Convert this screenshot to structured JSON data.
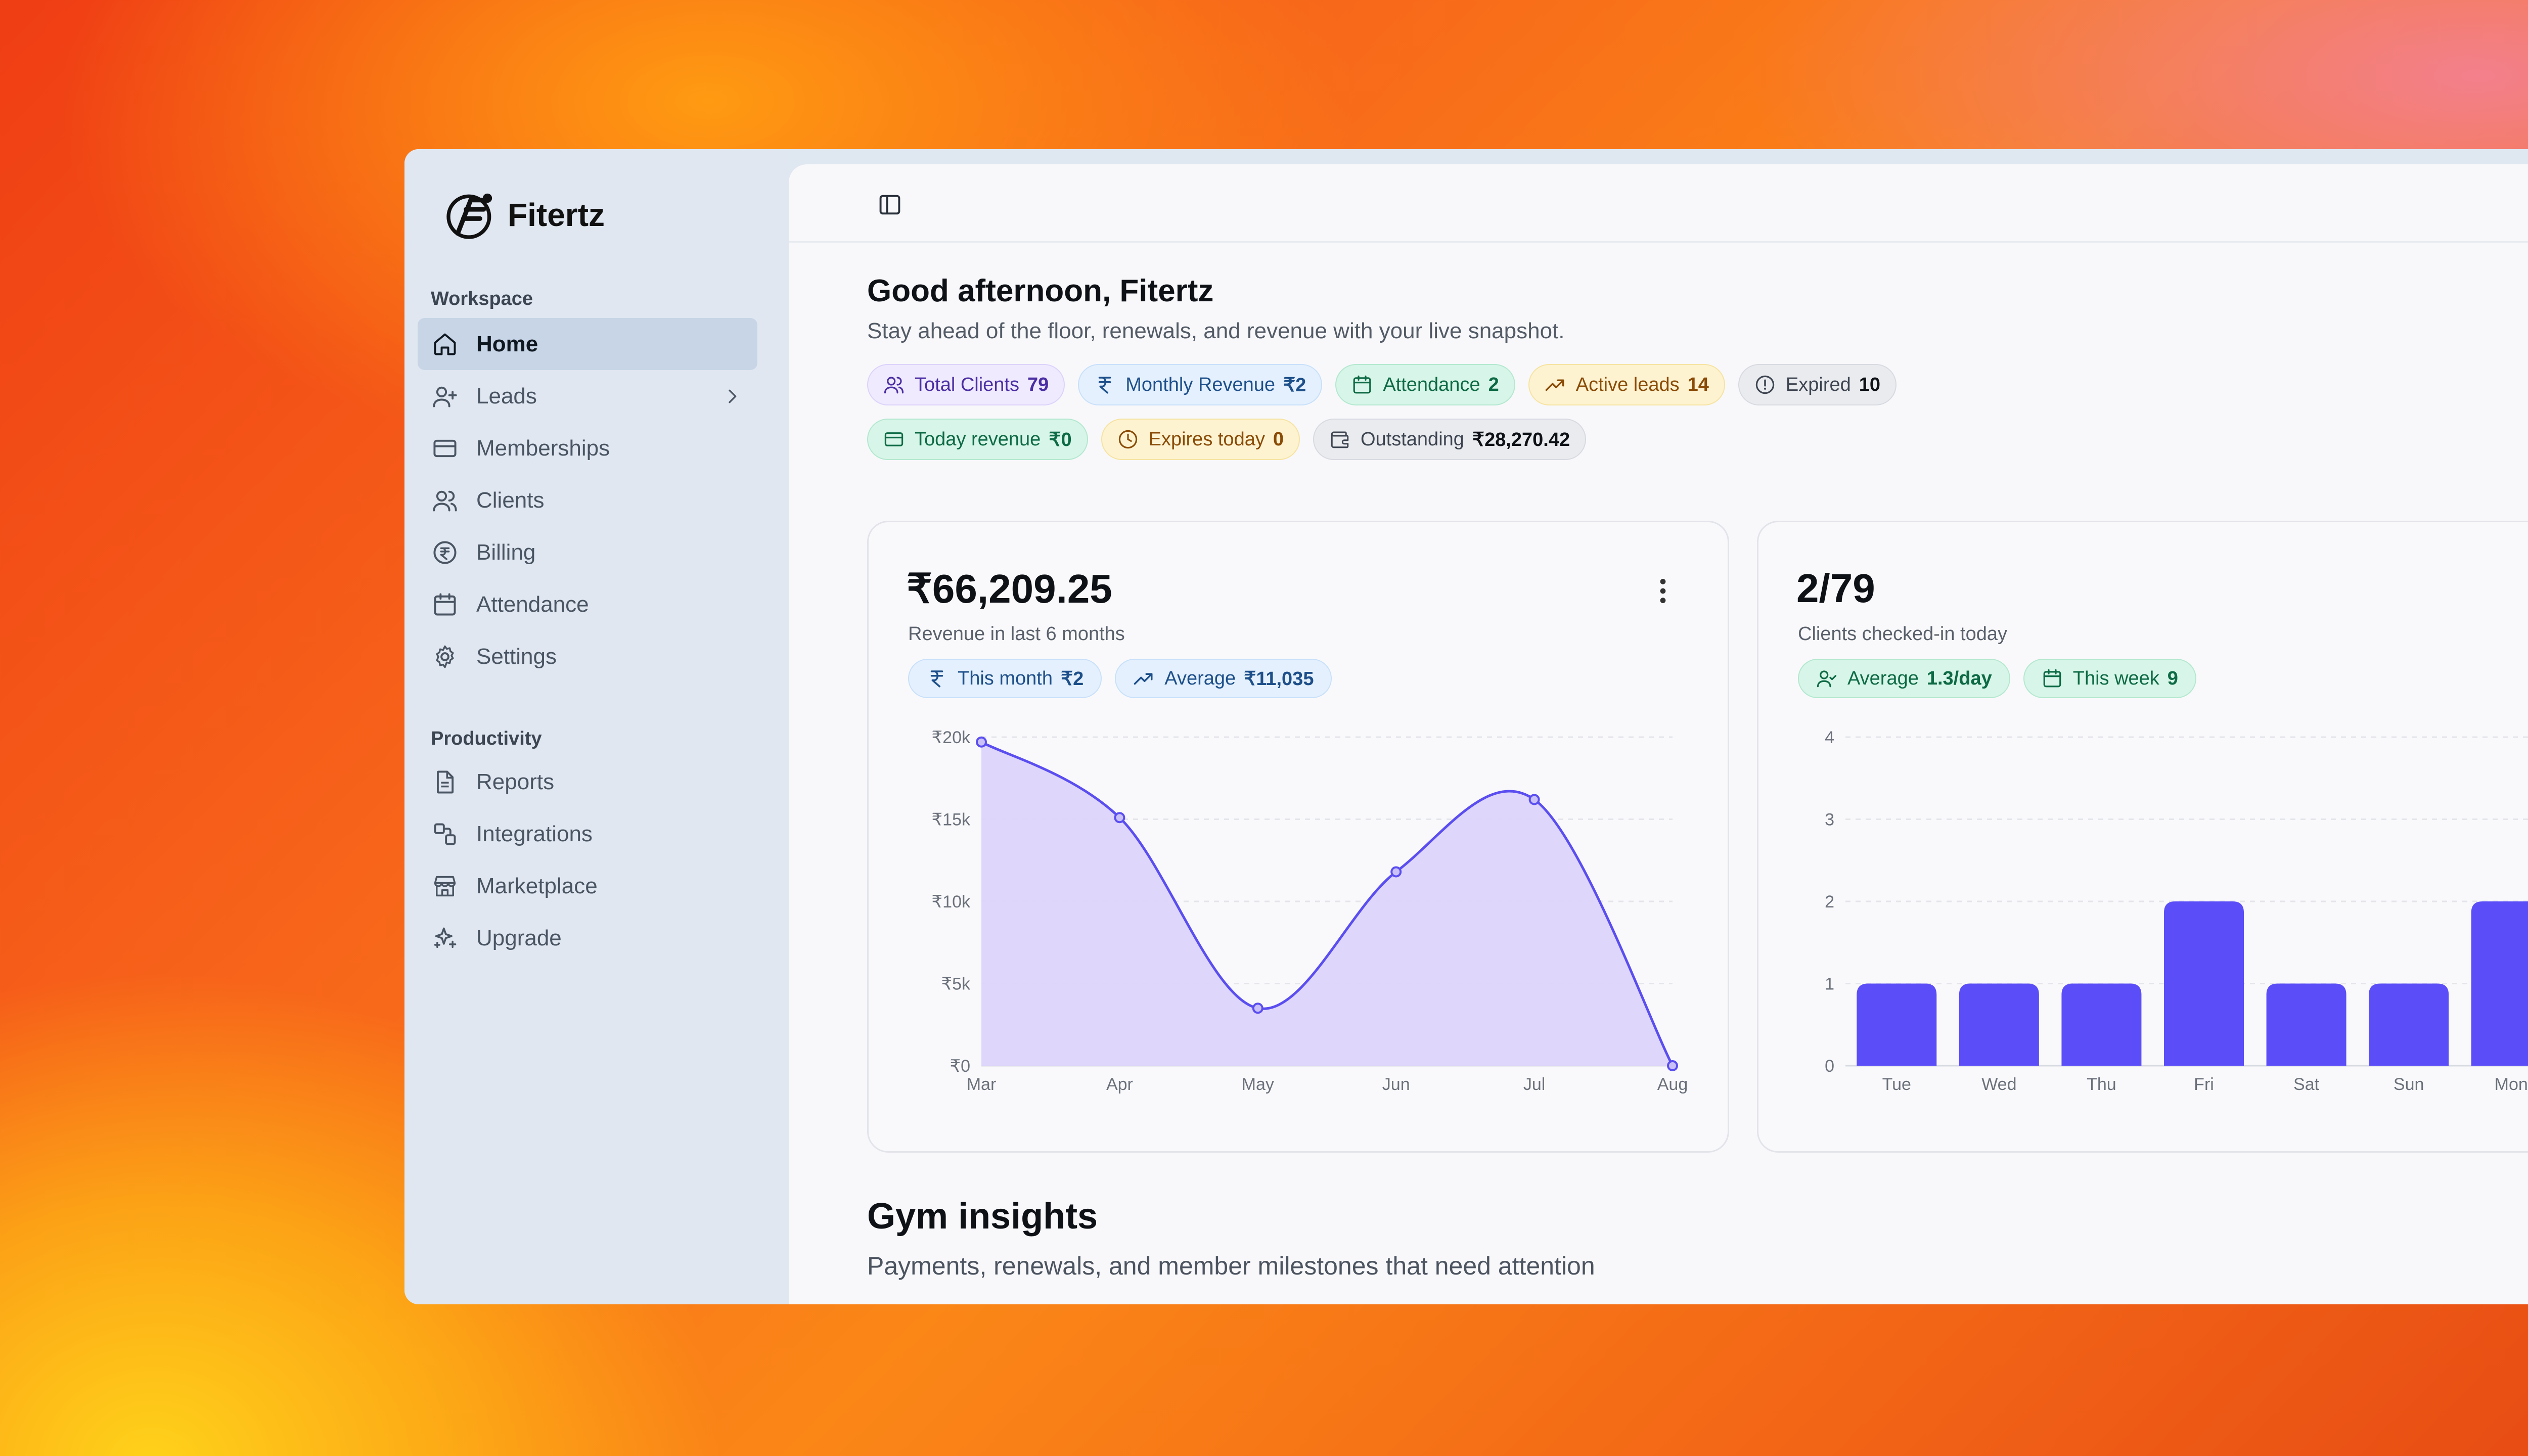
{
  "brand": {
    "name": "Fitertz"
  },
  "sidebar": {
    "workspace_label": "Workspace",
    "productivity_label": "Productivity",
    "workspace_items": [
      {
        "label": "Home",
        "icon": "home-icon",
        "active": true
      },
      {
        "label": "Leads",
        "icon": "user-plus-icon",
        "has_submenu": true
      },
      {
        "label": "Memberships",
        "icon": "card-icon"
      },
      {
        "label": "Clients",
        "icon": "users-icon"
      },
      {
        "label": "Billing",
        "icon": "rupee-circle-icon"
      },
      {
        "label": "Attendance",
        "icon": "calendar-icon"
      },
      {
        "label": "Settings",
        "icon": "gear-icon"
      }
    ],
    "productivity_items": [
      {
        "label": "Reports",
        "icon": "file-icon"
      },
      {
        "label": "Integrations",
        "icon": "integrations-icon"
      },
      {
        "label": "Marketplace",
        "icon": "store-icon"
      },
      {
        "label": "Upgrade",
        "icon": "sparkles-icon"
      }
    ]
  },
  "header": {
    "greeting": "Good afternoon, Fitertz",
    "subtitle": "Stay ahead of the floor, renewals, and revenue with your live snapshot."
  },
  "stats": {
    "row1": [
      {
        "label": "Total Clients",
        "value": "79",
        "icon": "users-icon",
        "color": "#efeafe"
      },
      {
        "label": "Monthly Revenue",
        "value": "₹2",
        "icon": "rupee-icon",
        "color": "#e4f0fd"
      },
      {
        "label": "Attendance",
        "value": "2",
        "icon": "calendar-icon",
        "color": "#d7f5e8"
      },
      {
        "label": "Active leads",
        "value": "14",
        "icon": "trend-up-icon",
        "color": "#fdf3d1"
      },
      {
        "label": "Expired",
        "value": "10",
        "icon": "alert-circle-icon",
        "color": "#e9ebef"
      }
    ],
    "row2": [
      {
        "label": "Today revenue",
        "value": "₹0",
        "icon": "card-icon",
        "color": "#d7f5e8"
      },
      {
        "label": "Expires today",
        "value": "0",
        "icon": "clock-icon",
        "color": "#fdf3d1"
      },
      {
        "label": "Outstanding",
        "value": "₹28,270.42",
        "icon": "wallet-icon",
        "color": "#e9ebef"
      }
    ]
  },
  "revenue_card": {
    "amount": "₹66,209.25",
    "caption": "Revenue in last 6 months",
    "chips": [
      {
        "label": "This month",
        "value": "₹2",
        "icon": "rupee-icon"
      },
      {
        "label": "Average",
        "value": "₹11,035",
        "icon": "trend-up-icon"
      }
    ]
  },
  "attendance_card": {
    "amount": "2/79",
    "caption": "Clients checked-in today",
    "chips": [
      {
        "label": "Average",
        "value": "1.3/day",
        "icon": "user-check-icon"
      },
      {
        "label": "This week",
        "value": "9",
        "icon": "calendar-icon"
      }
    ]
  },
  "insights": {
    "title": "Gym insights",
    "subtitle": "Payments, renewals, and member milestones that need attention"
  },
  "chart_data": [
    {
      "type": "area",
      "x": [
        "Mar",
        "Apr",
        "May",
        "Jun",
        "Jul",
        "Aug"
      ],
      "values": [
        19700,
        15100,
        3500,
        11800,
        16200,
        0
      ],
      "ylim": [
        0,
        20000
      ],
      "yticks": [
        "₹0",
        "₹5k",
        "₹10k",
        "₹15k",
        "₹20k"
      ],
      "grid": true,
      "color": "#5b4ef0",
      "fill": "#dcd5fb"
    },
    {
      "type": "bar",
      "categories": [
        "Tue",
        "Wed",
        "Thu",
        "Fri",
        "Sat",
        "Sun",
        "Mon"
      ],
      "values": [
        1,
        1,
        1,
        2,
        1,
        1,
        2
      ],
      "ylim": [
        0,
        4
      ],
      "yticks": [
        "0",
        "1",
        "2",
        "3",
        "4"
      ],
      "grid": true,
      "color": "#5b4ef8"
    }
  ]
}
